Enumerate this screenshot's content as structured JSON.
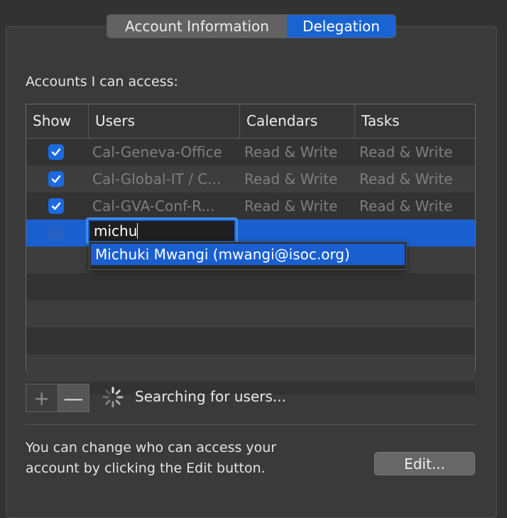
{
  "tabs": [
    {
      "label": "Account Information",
      "active": false
    },
    {
      "label": "Delegation",
      "active": true
    }
  ],
  "section_label": "Accounts I can access:",
  "table": {
    "headers": {
      "show": "Show",
      "users": "Users",
      "calendars": "Calendars",
      "tasks": "Tasks"
    },
    "rows": [
      {
        "checked": true,
        "user": "Cal-Geneva-Office",
        "calendars": "Read & Write",
        "tasks": "Read & Write"
      },
      {
        "checked": true,
        "user": "Cal-Global-IT / C...",
        "calendars": "Read & Write",
        "tasks": "Read & Write"
      },
      {
        "checked": true,
        "user": "Cal-GVA-Conf-R...",
        "calendars": "Read & Write",
        "tasks": "Read & Write"
      }
    ],
    "editing_row": {
      "checked": false,
      "input_value": "michu"
    }
  },
  "suggestion": "Michuki Mwangi (mwangi@isoc.org)",
  "add_button": "+",
  "remove_button": "—",
  "search_status": "Searching for users...",
  "help_text": "You can change who can access your account by clicking the Edit button.",
  "edit_button": "Edit...",
  "colors": {
    "accent": "#1a5fcf",
    "background": "#323232"
  }
}
